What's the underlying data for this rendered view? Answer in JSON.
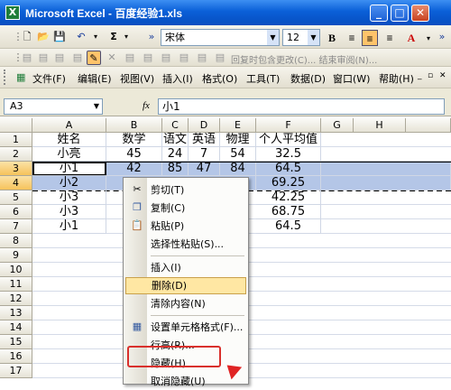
{
  "window": {
    "title": "Microsoft Excel - 百度经验1.xls",
    "min": "_",
    "max": "□",
    "close": "✕"
  },
  "toolbar": {
    "font_name": "宋体",
    "font_size": "12",
    "bold": "B",
    "sum": "Σ",
    "review_text": "回复时包含更改(C)... 结束审阅(N)..."
  },
  "menu": {
    "items": [
      "文件(F)",
      "编辑(E)",
      "视图(V)",
      "插入(I)",
      "格式(O)",
      "工具(T)",
      "数据(D)",
      "窗口(W)",
      "帮助(H)"
    ]
  },
  "formula_bar": {
    "name_box": "A3",
    "fx": "fx",
    "value": "小1"
  },
  "sheet": {
    "columns": [
      "A",
      "B",
      "C",
      "D",
      "E",
      "F",
      "G",
      "H"
    ],
    "rows": [
      "1",
      "2",
      "3",
      "4",
      "5",
      "6",
      "7",
      "8",
      "9",
      "10",
      "11",
      "12",
      "13",
      "14",
      "15",
      "16",
      "17"
    ],
    "data": [
      [
        "姓名",
        "数学",
        "语文",
        "英语",
        "物理",
        "个人平均值"
      ],
      [
        "小亮",
        "45",
        "24",
        "7",
        "54",
        "32.5"
      ],
      [
        "小1",
        "42",
        "85",
        "47",
        "84",
        "64.5"
      ],
      [
        "小2",
        "",
        "",
        "",
        "",
        "69.25"
      ],
      [
        "小3",
        "",
        "",
        "",
        "",
        "42.25"
      ],
      [
        "小3",
        "",
        "",
        "",
        "",
        "68.75"
      ],
      [
        "小1",
        "",
        "",
        "",
        "",
        "64.5"
      ]
    ]
  },
  "context_menu": {
    "items": [
      {
        "label": "剪切(T)",
        "icon": "scissors-icon"
      },
      {
        "label": "复制(C)",
        "icon": "copy-icon"
      },
      {
        "label": "粘贴(P)",
        "icon": "paste-icon"
      },
      {
        "label": "选择性粘贴(S)...",
        "icon": ""
      },
      {
        "label": "插入(I)",
        "icon": ""
      },
      {
        "label": "删除(D)",
        "icon": ""
      },
      {
        "label": "清除内容(N)",
        "icon": ""
      },
      {
        "label": "设置单元格格式(F)...",
        "icon": "format-cells-icon"
      },
      {
        "label": "行高(R)...",
        "icon": ""
      },
      {
        "label": "隐藏(H)",
        "icon": ""
      },
      {
        "label": "取消隐藏(U)",
        "icon": ""
      }
    ],
    "hovered": "删除(D)",
    "highlighted": "隐藏(H)"
  },
  "colors": {
    "title_blue": "#0a5fd8",
    "selection": "#b4c6e7",
    "annotation_red": "#d9302c"
  }
}
